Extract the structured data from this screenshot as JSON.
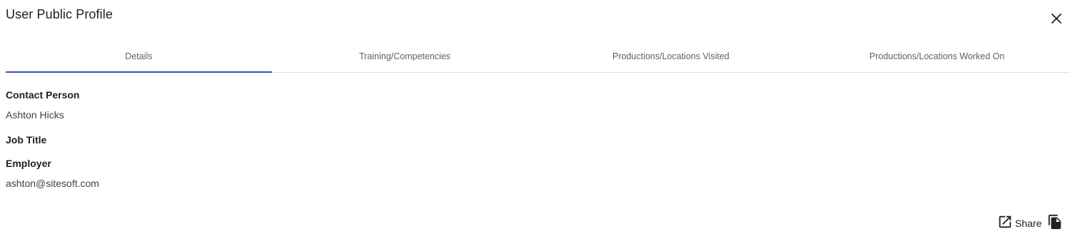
{
  "dialog": {
    "title": "User Public Profile"
  },
  "tabs": [
    {
      "label": "Details",
      "active": true
    },
    {
      "label": "Training/Competencies",
      "active": false
    },
    {
      "label": "Productions/Locations Visited",
      "active": false
    },
    {
      "label": "Productions/Locations Worked On",
      "active": false
    }
  ],
  "details": {
    "contact_person_label": "Contact Person",
    "contact_person_value": "Ashton Hicks",
    "job_title_label": "Job Title",
    "employer_label": "Employer",
    "employer_value": "ashton@sitesoft.com"
  },
  "footer": {
    "share_label": "Share"
  },
  "colors": {
    "accent": "#3f51b5",
    "text": "#212121",
    "muted": "#616161",
    "divider": "#e0e0e0"
  },
  "icons": {
    "close": "close-icon",
    "open_external": "open-in-new-icon",
    "copy": "copy-icon"
  }
}
